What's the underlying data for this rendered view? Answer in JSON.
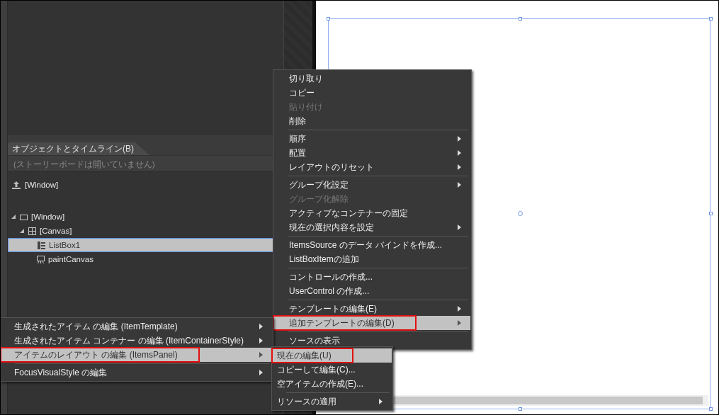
{
  "objects_panel": {
    "tab": "オブジェクトとタイムライン(B)",
    "storyboard_status": "(ストーリーボードは開いていません)",
    "scope_item": "[Window]",
    "tree": [
      {
        "label": "[Window]",
        "kind": "window",
        "expanded": true,
        "selected": false,
        "children": [
          {
            "label": "[Canvas]",
            "kind": "canvas",
            "expanded": true,
            "selected": false,
            "children": [
              {
                "label": "ListBox1",
                "kind": "listbox",
                "selected": true
              },
              {
                "label": "paintCanvas",
                "kind": "paint",
                "selected": false
              }
            ]
          }
        ]
      }
    ]
  },
  "context_menu": {
    "items": [
      {
        "kind": "item",
        "label": "切り取り",
        "disabled": false,
        "has_submenu": false,
        "selected": false,
        "marked": false
      },
      {
        "kind": "item",
        "label": "コピー",
        "disabled": false,
        "has_submenu": false,
        "selected": false,
        "marked": false
      },
      {
        "kind": "item",
        "label": "貼り付け",
        "disabled": true,
        "has_submenu": false,
        "selected": false,
        "marked": false
      },
      {
        "kind": "item",
        "label": "削除",
        "disabled": false,
        "has_submenu": false,
        "selected": false,
        "marked": false
      },
      {
        "kind": "separator"
      },
      {
        "kind": "item",
        "label": "順序",
        "disabled": false,
        "has_submenu": true,
        "selected": false,
        "marked": false
      },
      {
        "kind": "item",
        "label": "配置",
        "disabled": false,
        "has_submenu": true,
        "selected": false,
        "marked": false
      },
      {
        "kind": "item",
        "label": "レイアウトのリセット",
        "disabled": false,
        "has_submenu": true,
        "selected": false,
        "marked": false
      },
      {
        "kind": "separator"
      },
      {
        "kind": "item",
        "label": "グループ化設定",
        "disabled": false,
        "has_submenu": true,
        "selected": false,
        "marked": false
      },
      {
        "kind": "item",
        "label": "グループ化解除",
        "disabled": true,
        "has_submenu": false,
        "selected": false,
        "marked": false
      },
      {
        "kind": "item",
        "label": "アクティブなコンテナーの固定",
        "disabled": false,
        "has_submenu": false,
        "selected": false,
        "marked": false
      },
      {
        "kind": "item",
        "label": "現在の選択内容を設定",
        "disabled": false,
        "has_submenu": true,
        "selected": false,
        "marked": false
      },
      {
        "kind": "separator"
      },
      {
        "kind": "item",
        "label": "ItemsSource のデータ バインドを作成...",
        "disabled": false,
        "has_submenu": false,
        "selected": false,
        "marked": false
      },
      {
        "kind": "item",
        "label": "ListBoxItemの追加",
        "disabled": false,
        "has_submenu": false,
        "selected": false,
        "marked": false
      },
      {
        "kind": "separator"
      },
      {
        "kind": "item",
        "label": "コントロールの作成...",
        "disabled": false,
        "has_submenu": false,
        "selected": false,
        "marked": false
      },
      {
        "kind": "item",
        "label": "UserControl の作成...",
        "disabled": false,
        "has_submenu": false,
        "selected": false,
        "marked": false
      },
      {
        "kind": "separator"
      },
      {
        "kind": "item",
        "label": "テンプレートの編集(E)",
        "disabled": false,
        "has_submenu": true,
        "selected": false,
        "marked": false
      },
      {
        "kind": "item",
        "label": "追加テンプレートの編集(D)",
        "disabled": false,
        "has_submenu": true,
        "selected": true,
        "marked": true
      },
      {
        "kind": "separator"
      },
      {
        "kind": "item",
        "label": "ソースの表示",
        "disabled": false,
        "has_submenu": false,
        "selected": false,
        "marked": false
      }
    ]
  },
  "template_submenu": {
    "items": [
      {
        "kind": "item",
        "label": "生成されたアイテム の編集 (ItemTemplate)",
        "disabled": false,
        "has_submenu": true,
        "selected": false,
        "marked": false
      },
      {
        "kind": "item",
        "label": "生成されたアイテム コンテナー の編集 (ItemContainerStyle)",
        "disabled": false,
        "has_submenu": true,
        "selected": false,
        "marked": false
      },
      {
        "kind": "item",
        "label": "アイテムのレイアウト の編集 (ItemsPanel)",
        "disabled": false,
        "has_submenu": true,
        "selected": true,
        "marked": true
      },
      {
        "kind": "separator"
      },
      {
        "kind": "item",
        "label": "FocusVisualStyle の編集",
        "disabled": false,
        "has_submenu": true,
        "selected": false,
        "marked": false
      }
    ]
  },
  "panel_submenu": {
    "items": [
      {
        "kind": "item",
        "label": "現在の編集(U)",
        "disabled": false,
        "has_submenu": false,
        "selected": true,
        "marked": true
      },
      {
        "kind": "item",
        "label": "コピーして編集(C)...",
        "disabled": false,
        "has_submenu": false,
        "selected": false,
        "marked": false
      },
      {
        "kind": "item",
        "label": "空アイテムの作成(E)...",
        "disabled": false,
        "has_submenu": false,
        "selected": false,
        "marked": false
      },
      {
        "kind": "separator"
      },
      {
        "kind": "item",
        "label": "リソースの適用",
        "disabled": false,
        "has_submenu": true,
        "selected": false,
        "marked": false
      }
    ]
  }
}
